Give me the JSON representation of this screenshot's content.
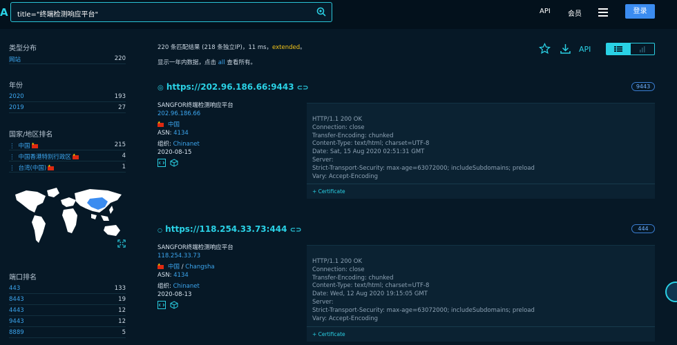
{
  "topbar": {
    "logo": "A",
    "search_value": "title=\"终端检测响应平台\"",
    "nav": {
      "api": "API",
      "member": "会员"
    },
    "login": "登录"
  },
  "sidebar": {
    "type_title": "类型分布",
    "types": [
      {
        "label": "网站",
        "count": "220"
      }
    ],
    "year_title": "年份",
    "years": [
      {
        "label": "2020",
        "count": "193"
      },
      {
        "label": "2019",
        "count": "27"
      }
    ],
    "country_title": "国家/地区排名",
    "countries": [
      {
        "label": "中国",
        "count": "215"
      },
      {
        "label": "中国香港特别行政区",
        "count": "4"
      },
      {
        "label": "台湾(中国)",
        "count": "1"
      }
    ],
    "port_title": "端口排名",
    "ports": [
      {
        "label": "443",
        "count": "133"
      },
      {
        "label": "8443",
        "count": "19"
      },
      {
        "label": "4443",
        "count": "12"
      },
      {
        "label": "9443",
        "count": "12"
      },
      {
        "label": "8889",
        "count": "5"
      }
    ]
  },
  "summary": {
    "prefix": "220 条匹配结果 (218 条独立IP)，11 ms，",
    "extended": "extended",
    "suffix": "。",
    "line2_prefix": "显示一年内数据，点击 ",
    "all": "all",
    "line2_suffix": " 查看所有。",
    "api": "API"
  },
  "results": [
    {
      "url": "https://202.96.186.66:9443",
      "port": "9443",
      "title": "SANGFOR终端检测响应平台",
      "ip": "202.96.186.66",
      "country": "中国",
      "city": "",
      "asn_label": "ASN: ",
      "asn": "4134",
      "org_label": "组织: ",
      "org": "Chinanet",
      "date": "2020-08-15",
      "headers": "HTTP/1.1 200 OK\nConnection: close\nTransfer-Encoding: chunked\nContent-Type: text/html; charset=UTF-8\nDate: Sat, 15 Aug 2020 02:51:31 GMT\nServer:\nStrict-Transport-Security: max-age=63072000; includeSubdomains; preload\nVary: Accept-Encoding",
      "cert": "Certificate"
    },
    {
      "url": "https://118.254.33.73:444",
      "port": "444",
      "title": "SANGFOR终端检测响应平台",
      "ip": "118.254.33.73",
      "country": "中国",
      "city": "Changsha",
      "asn_label": "ASN: ",
      "asn": "4134",
      "org_label": "组织: ",
      "org": "Chinanet",
      "date": "2020-08-13",
      "headers": "HTTP/1.1 200 OK\nConnection: close\nTransfer-Encoding: chunked\nContent-Type: text/html; charset=UTF-8\nDate: Wed, 12 Aug 2020 19:15:05 GMT\nServer:\nStrict-Transport-Security: max-age=63072000; includeSubdomains; preload\nVary: Accept-Encoding",
      "cert": "Certificate"
    }
  ],
  "colors": {
    "accent": "#2ad1e5",
    "link": "#3ca6ef",
    "login": "#3b8cf0",
    "highlight": "#f5c518"
  }
}
